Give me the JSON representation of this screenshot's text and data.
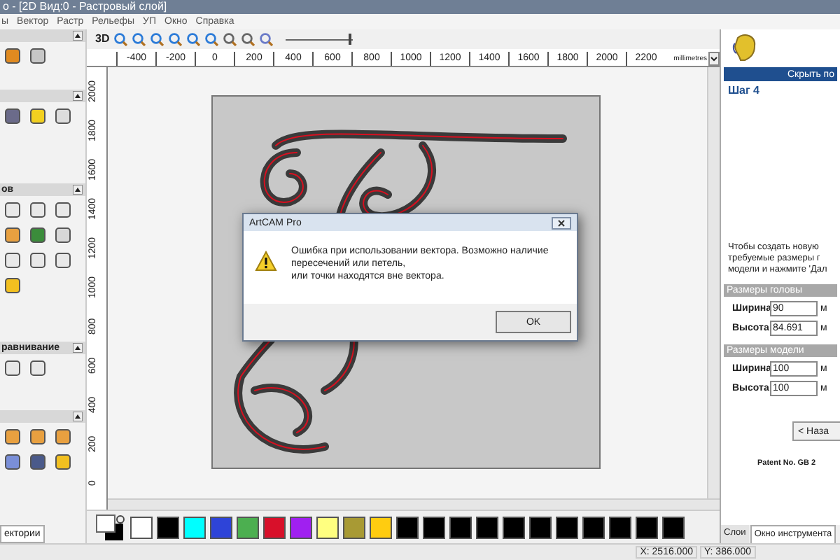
{
  "window": {
    "title": "о - [2D Вид:0 - Растровый слой]"
  },
  "menu": [
    "ы",
    "Вектор",
    "Растр",
    "Рельефы",
    "УП",
    "Окно",
    "Справка"
  ],
  "toolbar": {
    "view_3d": "3D",
    "zoom_slider": {
      "level": 0.95
    }
  },
  "ruler": {
    "x_labels": [
      "-400",
      "-200",
      "0",
      "200",
      "400",
      "600",
      "800",
      "1000",
      "1200",
      "1400",
      "1600",
      "1800",
      "2000",
      "2200"
    ],
    "units": "millimetres",
    "y_labels": [
      "2000",
      "1800",
      "1600",
      "1400",
      "1200",
      "1000",
      "800",
      "600",
      "400",
      "200",
      "0"
    ]
  },
  "left_panel": {
    "sections": [
      {
        "title": "ов"
      },
      {
        "title": "равнивание"
      }
    ],
    "bottom_tab": "ектории"
  },
  "dialog": {
    "title": "ArtCAM Pro",
    "message_lines": [
      "Ошибка при использовании вектора. Возможно наличие",
      "пересечений или петель,",
      "или точки находятся вне вектора."
    ],
    "ok": "OK"
  },
  "palette": [
    {
      "color": "#ffffff"
    },
    {
      "color": "#000000"
    },
    {
      "color": "#00ffff"
    },
    {
      "color": "#2e44d8"
    },
    {
      "color": "#4caf50"
    },
    {
      "color": "#d8102a"
    },
    {
      "color": "#a020f0"
    },
    {
      "color": "#ffff80"
    },
    {
      "color": "#a89a34"
    },
    {
      "color": "#ffcc10"
    },
    {
      "color": "#000000"
    },
    {
      "color": "#000000"
    },
    {
      "color": "#000000"
    },
    {
      "color": "#000000"
    },
    {
      "color": "#000000"
    },
    {
      "color": "#000000"
    },
    {
      "color": "#000000"
    },
    {
      "color": "#000000"
    },
    {
      "color": "#000000"
    },
    {
      "color": "#000000"
    },
    {
      "color": "#000000"
    }
  ],
  "right_panel": {
    "hide_button": "Скрыть по",
    "step": "Шаг 4",
    "instructions": [
      "Чтобы создать новую",
      "требуемые размеры г",
      "модели и нажмите 'Дал"
    ],
    "groups": [
      {
        "title": "Размеры головы",
        "fields": [
          {
            "label": "Ширина",
            "value": "90",
            "unit": "м"
          },
          {
            "label": "Высота",
            "value": "84.691",
            "unit": "м"
          }
        ]
      },
      {
        "title": "Размеры модели",
        "fields": [
          {
            "label": "Ширина",
            "value": "100",
            "unit": "м"
          },
          {
            "label": "Высота",
            "value": "100",
            "unit": "м"
          }
        ]
      }
    ],
    "back_button": "< Наза",
    "patent": "Patent No. GB 2",
    "tabs": [
      {
        "label": "Слои",
        "selected": false
      },
      {
        "label": "Окно инструмента",
        "selected": true
      }
    ]
  },
  "status_bar": {
    "x": "X: 2516.000",
    "y": "Y: 386.000"
  }
}
